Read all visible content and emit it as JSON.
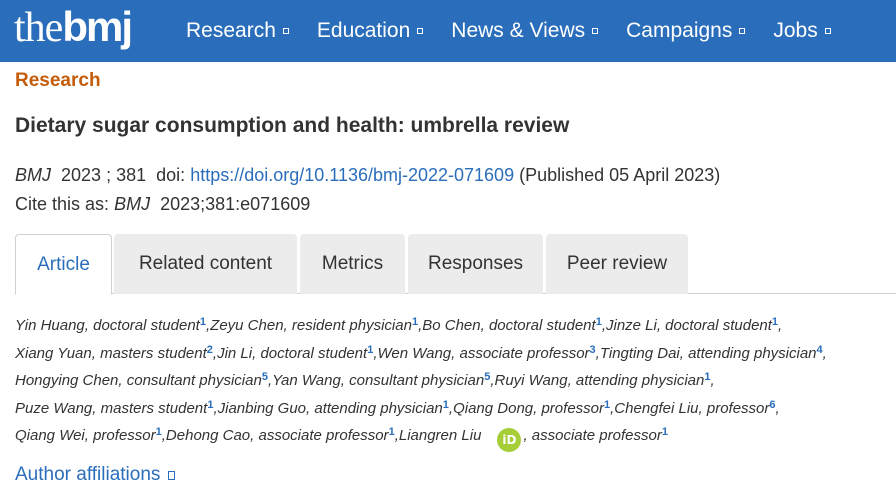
{
  "header": {
    "logo_the": "the",
    "logo_bmj": "bmj",
    "nav": [
      "Research",
      "Education",
      "News & Views",
      "Campaigns",
      "Jobs"
    ]
  },
  "section_label": "Research",
  "title": "Dietary sugar consumption and health: umbrella review",
  "citation": {
    "journal": "BMJ",
    "year": "2023",
    "volume": "381",
    "doi_label": "doi:",
    "doi": "https://doi.org/10.1136/bmj-2022-071609",
    "published": "(Published 05 April 2023)",
    "cite_as_label": "Cite this as:",
    "cite_as_journal": "BMJ",
    "cite_as_ref": "2023;381:e071609"
  },
  "tabs": [
    "Article",
    "Related content",
    "Metrics",
    "Responses",
    "Peer review"
  ],
  "active_tab": "Article",
  "authors": [
    {
      "name": "Yin Huang, doctoral student",
      "aff": "1"
    },
    {
      "name": "Zeyu Chen, resident physician",
      "aff": "1"
    },
    {
      "name": "Bo Chen, doctoral student",
      "aff": "1"
    },
    {
      "name": "Jinze Li, doctoral student",
      "aff": "1"
    },
    {
      "name": "Xiang Yuan, masters student",
      "aff": "2"
    },
    {
      "name": "Jin Li, doctoral student",
      "aff": "1"
    },
    {
      "name": "Wen Wang, associate professor",
      "aff": "3"
    },
    {
      "name": "Tingting Dai, attending physician",
      "aff": "4"
    },
    {
      "name": "Hongying Chen, consultant physician",
      "aff": "5"
    },
    {
      "name": "Yan Wang, consultant physician",
      "aff": "5"
    },
    {
      "name": "Ruyi Wang, attending physician",
      "aff": "1"
    },
    {
      "name": "Puze Wang, masters student",
      "aff": "1"
    },
    {
      "name": "Jianbing Guo, attending physician",
      "aff": "1"
    },
    {
      "name": "Qiang Dong, professor",
      "aff": "1"
    },
    {
      "name": "Chengfei Liu, professor",
      "aff": "6"
    },
    {
      "name": "Qiang Wei, professor",
      "aff": "1"
    },
    {
      "name": "Dehong Cao, associate professor",
      "aff": "1"
    },
    {
      "name": "Liangren Liu",
      "role": ", associate professor",
      "aff": "1",
      "orcid": "iD"
    }
  ],
  "author_affiliations_label": "Author affiliations",
  "colors": {
    "brand_blue": "#2a6ebb",
    "section_orange": "#c45c0a",
    "orcid_green": "#a6ce39"
  }
}
